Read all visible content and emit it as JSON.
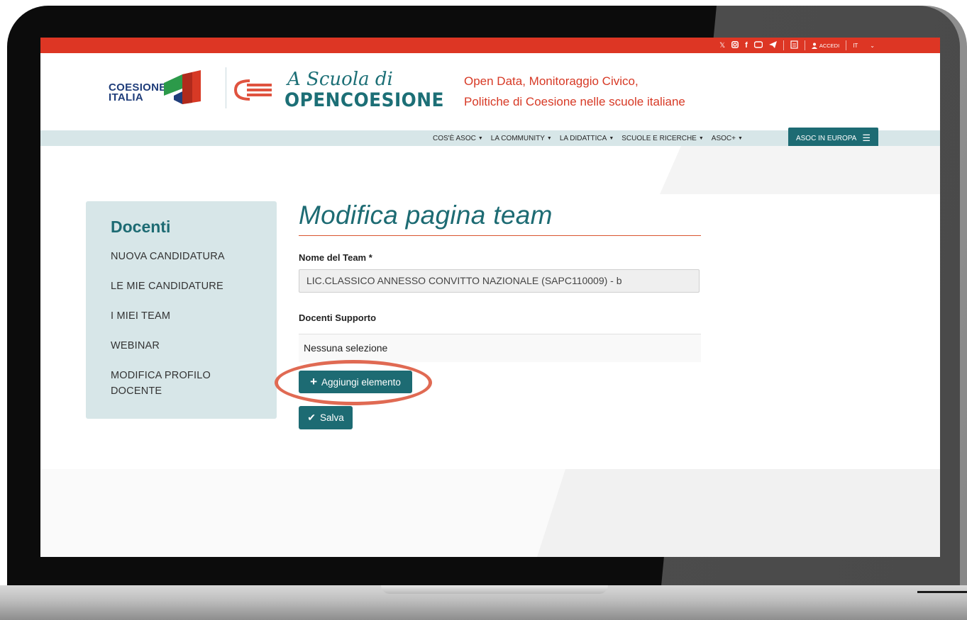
{
  "topbar": {
    "social_icons": [
      "x-icon",
      "instagram-icon",
      "facebook-icon",
      "youtube-icon",
      "telegram-icon",
      "contact-icon"
    ],
    "login_label": "ACCEDI",
    "language": "IT",
    "lang_caret": "⌄"
  },
  "header": {
    "coesione_line1": "COESIONE",
    "coesione_line2": "ITALIA",
    "asoc_script": "A Scuola di",
    "asoc_main": "OPENCOESIONE",
    "tagline_line1": "Open Data, Monitoraggio Civico,",
    "tagline_line2": "Politiche di Coesione nelle scuole italiane"
  },
  "nav": {
    "items": [
      {
        "label": "COS'È ASOC"
      },
      {
        "label": "LA COMMUNITY"
      },
      {
        "label": "LA DIDATTICA"
      },
      {
        "label": "SCUOLE E RICERCHE"
      },
      {
        "label": "ASOC+"
      }
    ],
    "europa_label": "ASOC IN EUROPA"
  },
  "sidebar": {
    "title": "Docenti",
    "items": [
      {
        "label": "NUOVA CANDIDATURA"
      },
      {
        "label": "LE MIE CANDIDATURE"
      },
      {
        "label": "I MIEI TEAM"
      },
      {
        "label": "WEBINAR"
      },
      {
        "label": "MODIFICA PROFILO"
      },
      {
        "label": "DOCENTE"
      }
    ]
  },
  "main": {
    "title": "Modifica pagina team",
    "team_name_label": "Nome del Team *",
    "team_name_value": "LIC.CLASSICO ANNESSO CONVITTO NAZIONALE (SAPC110009) - b",
    "support_label": "Docenti Supporto",
    "support_value": "Nessuna selezione",
    "add_button_label": "Aggiungi elemento",
    "save_button_label": "Salva"
  },
  "colors": {
    "accent_teal": "#1d6b73",
    "topbar_red": "#dd3624",
    "highlight_ring": "#e06a53"
  }
}
